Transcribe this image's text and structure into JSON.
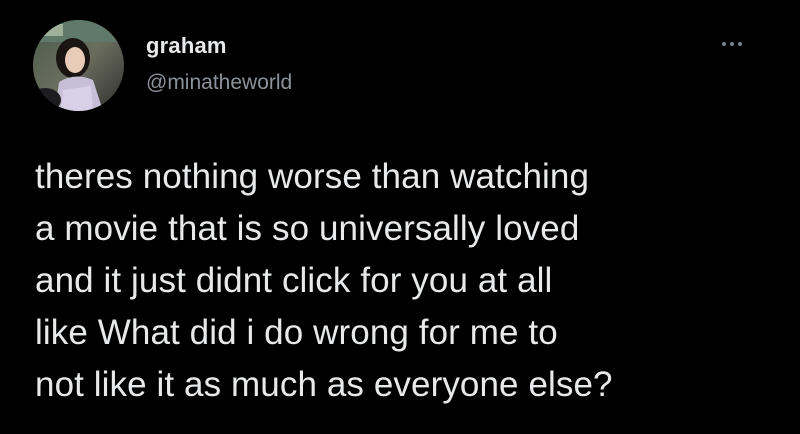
{
  "tweet": {
    "author": {
      "display_name": "graham",
      "handle": "@minatheworld"
    },
    "more_icon": "ellipsis-icon",
    "text_lines": [
      "theres nothing worse than watching",
      "a movie that is so universally loved",
      "and it just didnt click for you at all",
      "like What did i do wrong for me to",
      "not like it as much as everyone else?"
    ]
  },
  "colors": {
    "background": "#000000",
    "primary_text": "#e7e9ea",
    "secondary_text": "#8b9299"
  }
}
